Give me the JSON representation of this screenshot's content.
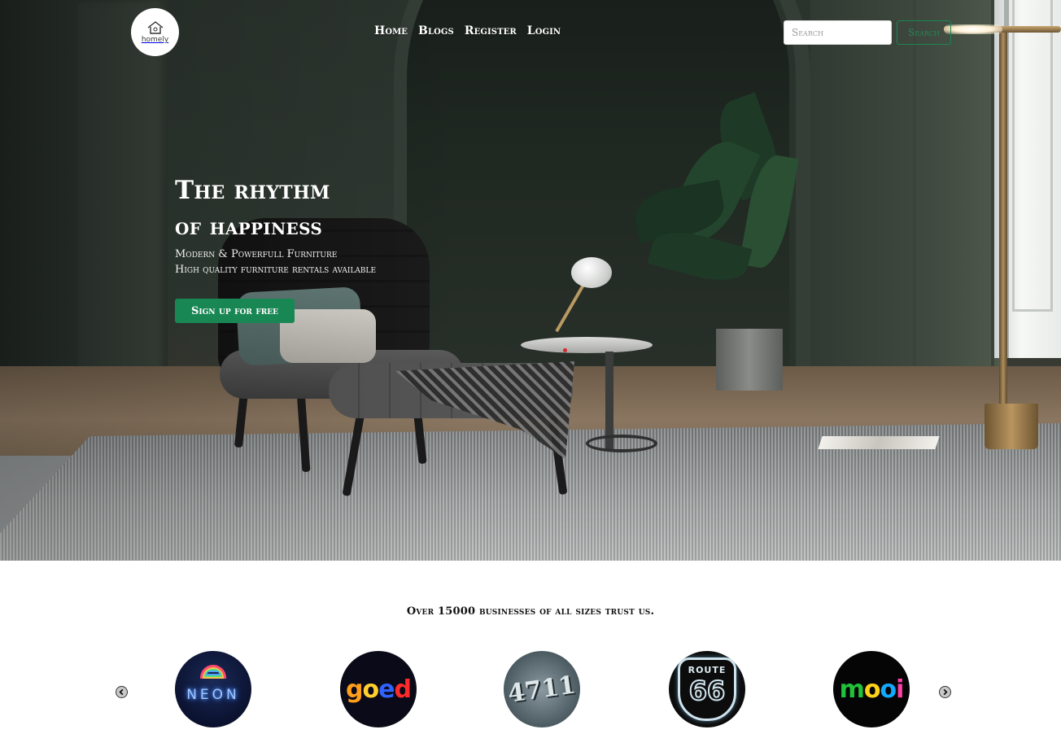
{
  "colors": {
    "accent": "#198754",
    "hero_text": "#ffffff",
    "page_background": "#ffffff"
  },
  "logo": {
    "text": "homely",
    "icon": "house-icon"
  },
  "nav": {
    "items": [
      {
        "label": "Home"
      },
      {
        "label": "Blogs"
      },
      {
        "label": "Register"
      },
      {
        "label": "Login"
      }
    ]
  },
  "search": {
    "placeholder": "Search",
    "button_label": "Search"
  },
  "hero": {
    "title_line_1": "The rhythm",
    "title_line_2": "of happiness",
    "subtitle_line_1": "Modern & Powerfull Furniture",
    "subtitle_line_2": "High quality furniture rentals available",
    "cta_label": "Sign up for free"
  },
  "trust": {
    "heading": "Over 15000 businesses of all sizes trust us.",
    "prev_icon": "chevron-left-icon",
    "next_icon": "chevron-right-icon",
    "brands": [
      {
        "name": "neon",
        "text": "NEON"
      },
      {
        "name": "goed",
        "letters": [
          "g",
          "o",
          "e",
          "d"
        ]
      },
      {
        "name": "4711",
        "text": "4711"
      },
      {
        "name": "route-66",
        "text_top": "ROUTE",
        "text_number": "66"
      },
      {
        "name": "mooi",
        "letters": [
          "m",
          "o",
          "o",
          "i"
        ]
      }
    ]
  }
}
